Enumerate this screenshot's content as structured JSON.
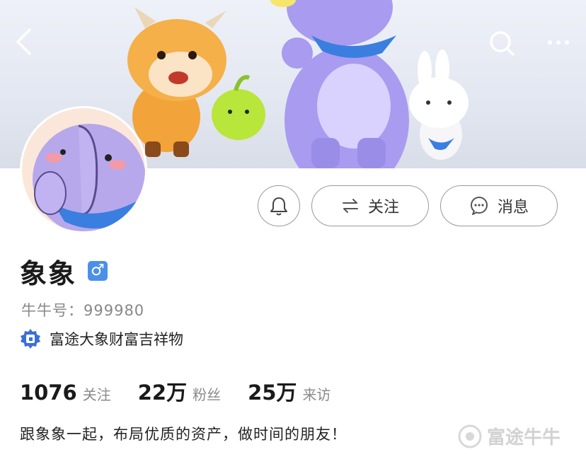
{
  "header": {
    "back_icon": "chevron-left-icon",
    "search_icon": "search-icon",
    "more_icon": "more-icon"
  },
  "actions": {
    "bell_icon": "bell-icon",
    "follow_label": "关注",
    "message_label": "消息"
  },
  "profile": {
    "name": "象象",
    "gender": "♂",
    "uid": "牛牛号：999980",
    "certification": "富途大象财富吉祥物"
  },
  "stats": [
    {
      "value": "1076",
      "label": "关注"
    },
    {
      "value": "22万",
      "label": "粉丝"
    },
    {
      "value": "25万",
      "label": "来访"
    }
  ],
  "bio": "跟象象一起，布局优质的资产，做时间的朋友！",
  "watermark": "富途牛牛",
  "colors": {
    "gender_badge": "#4a90e8",
    "cert_badge": "#3b6fd8",
    "button_border": "#9a9a9a"
  }
}
